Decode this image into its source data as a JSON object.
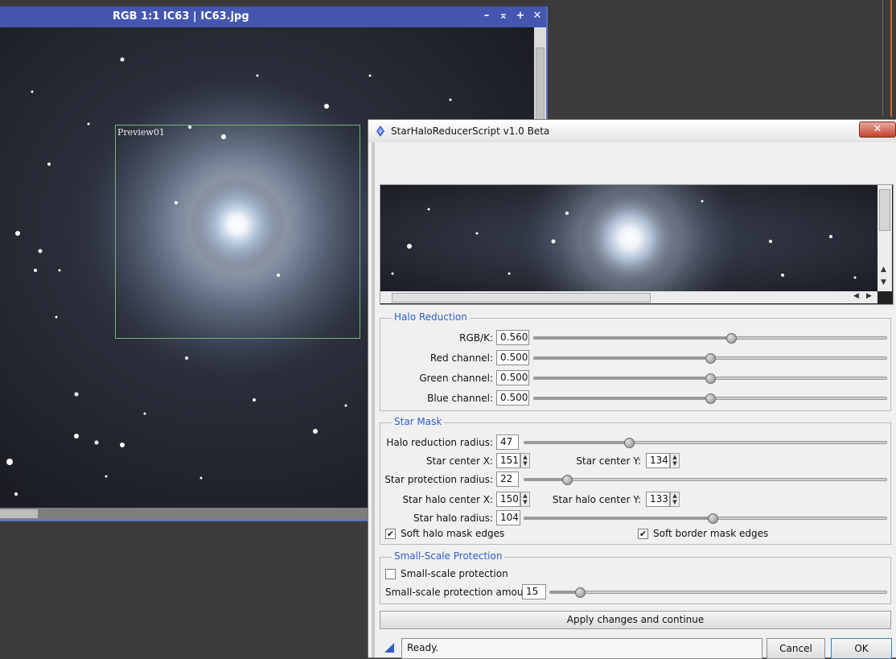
{
  "image_window": {
    "title": "RGB 1:1 IC63 | IC63.jpg",
    "preview_label": "Preview01",
    "controls": {
      "minimize": "–",
      "shade": "⌅",
      "maximize": "+",
      "close": "✕"
    }
  },
  "dialog": {
    "title": "StarHaloReducerScript v1.0 Beta",
    "close_glyph": "✕",
    "halo_reduction": {
      "title": "Halo Reduction",
      "rows": [
        {
          "label": "RGB/K:",
          "value": "0.560",
          "level": 0.56
        },
        {
          "label": "Red channel:",
          "value": "0.500",
          "level": 0.5
        },
        {
          "label": "Green channel:",
          "value": "0.500",
          "level": 0.5
        },
        {
          "label": "Blue channel:",
          "value": "0.500",
          "level": 0.5
        }
      ]
    },
    "star_mask": {
      "title": "Star Mask",
      "halo_reduction_radius": {
        "label": "Halo reduction radius:",
        "value": "47",
        "level": 0.29
      },
      "star_center_x": {
        "label": "Star center X:",
        "value": "151"
      },
      "star_center_y": {
        "label": "Star center Y:",
        "value": "134"
      },
      "star_protection_radius": {
        "label": "Star protection radius:",
        "value": "22",
        "level": 0.12
      },
      "star_halo_center_x": {
        "label": "Star halo center X:",
        "value": "150"
      },
      "star_halo_center_y": {
        "label": "Star halo center Y:",
        "value": "133"
      },
      "star_halo_radius": {
        "label": "Star halo radius:",
        "value": "104",
        "level": 0.52
      },
      "soft_halo_mask_edges": {
        "label": "Soft halo mask edges",
        "checked": true
      },
      "soft_border_mask_edges": {
        "label": "Soft border mask edges",
        "checked": true
      }
    },
    "small_scale": {
      "title": "Small-Scale Protection",
      "checkbox": {
        "label": "Small-scale protection",
        "checked": false
      },
      "amount": {
        "label": "Small-scale protection amount:",
        "value": "15",
        "level": 0.09
      }
    },
    "apply_button": "Apply changes and continue",
    "status": "Ready.",
    "cancel_button": "Cancel",
    "ok_button": "OK",
    "check_glyph": "✔",
    "spin_up": "▲",
    "spin_down": "▼",
    "arrow_left": "◀",
    "arrow_right": "▶"
  },
  "icons": [
    "pixinsight-icon",
    "help-triangle-icon"
  ],
  "colors": {
    "window_title": "#4456b0",
    "group_title": "#2f5ec8",
    "preview_box": "#76b07a",
    "close_red": "#c2422e"
  }
}
